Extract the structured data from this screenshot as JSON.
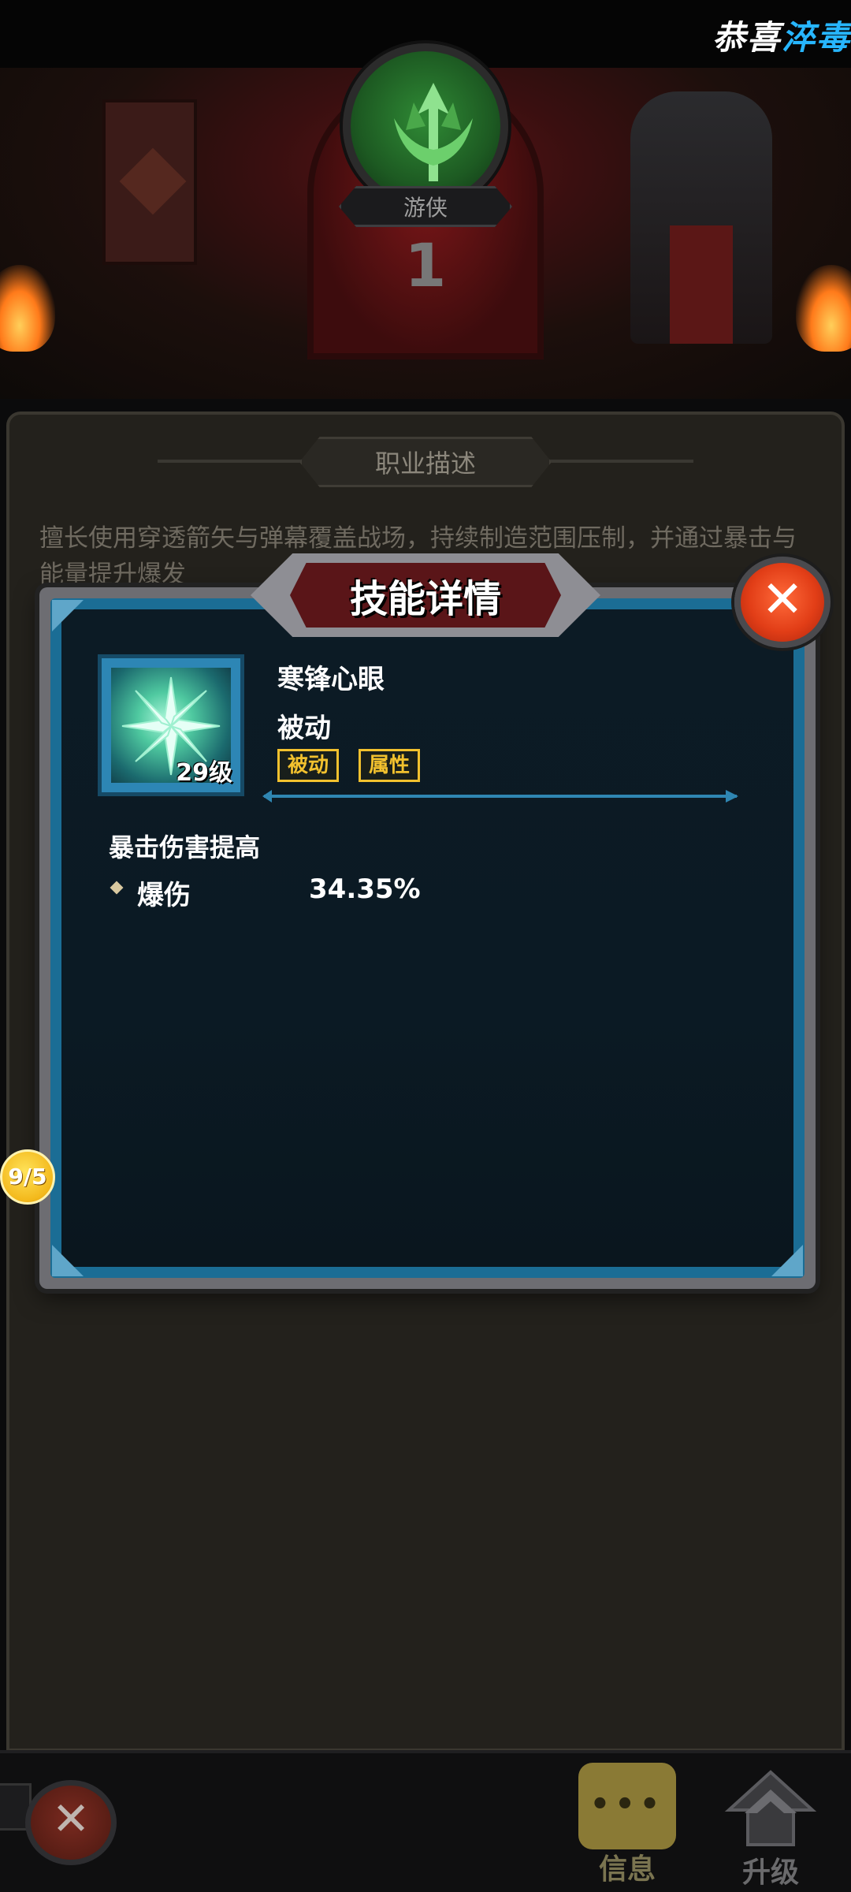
{
  "top_banner": {
    "congrats_white": "恭喜",
    "congrats_blue": "淬毒"
  },
  "hero": {
    "class_name": "游侠",
    "class_level": "1"
  },
  "description_section": {
    "title": "职业描述",
    "text": "擅长使用穿透箭矢与弹幕覆盖战场，持续制造范围压制，并通过暴击与能量提升爆发"
  },
  "skill_dialog": {
    "title": "技能详情",
    "close_label": "✕",
    "skill_name": "寒锋心眼",
    "skill_type": "被动",
    "skill_level": "29级",
    "tags": [
      "被动",
      "属性"
    ],
    "effect_title": "暴击伤害提高",
    "stats": [
      {
        "label": "爆伤",
        "value": "34.35%"
      }
    ]
  },
  "side_badge": "9/5",
  "bottom_bar": {
    "close_label": "✕",
    "info_label": "信息",
    "info_icon_text": "•••",
    "upgrade_label": "升级"
  },
  "colors": {
    "accent_gold": "#f2c12e",
    "dialog_blue": "#1b6d95",
    "close_red": "#e23e17",
    "congrats_blue": "#27b6ff"
  }
}
